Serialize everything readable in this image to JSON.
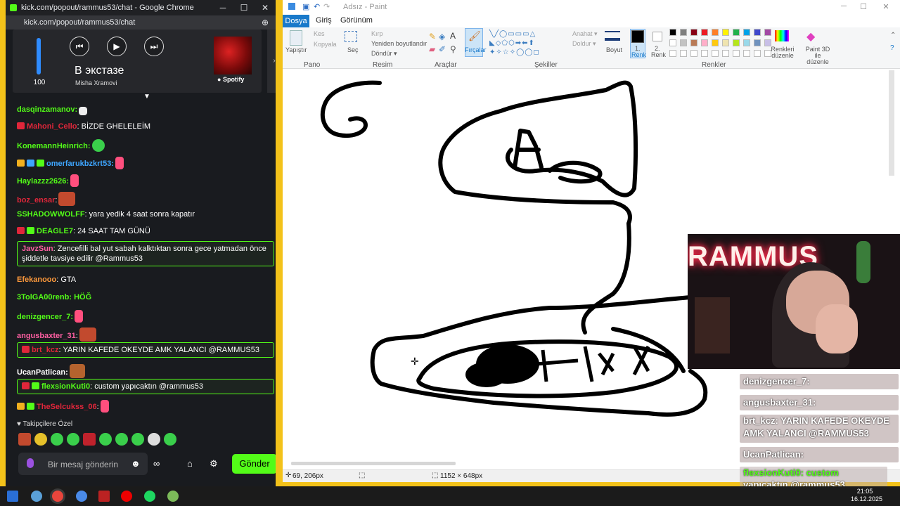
{
  "chrome": {
    "title": "kick.com/popout/rammus53/chat - Google Chrome",
    "url": "kick.com/popout/rammus53/chat",
    "minimize": "─",
    "maximize": "☐",
    "close": "✕",
    "zoom_icon": "⊕"
  },
  "spotify": {
    "volume": 100,
    "volume_label": "100",
    "song": "В экстазе",
    "artist": "Misha Xramovi",
    "logo_text": "Spotify",
    "prev_icon": "⏮",
    "play_icon": "▶",
    "next_icon": "⏭",
    "side_arrow": "›"
  },
  "chat": {
    "messages": [
      {
        "user": "dasqinzamanov:",
        "text": "",
        "color": "#53fc18"
      },
      {
        "user": "Mahoni_Cello",
        "text": ": BİZDE GHELELEİM",
        "color": "#e0263a"
      },
      {
        "user": "KonemannHeinrich:",
        "text": "",
        "color": "#53fc18"
      },
      {
        "user": "omerfarukbzkrt53:",
        "text": "",
        "color": "#3ea6ff"
      },
      {
        "user": "Haylazzz2626:",
        "text": "",
        "color": "#53fc18"
      },
      {
        "user": "boz_ensar",
        "text": ":",
        "color": "#e0263a"
      },
      {
        "user": "SSHADOWWOLFF",
        "text": ": yara yedik 4 saat sonra kapatır",
        "color": "#53fc18"
      },
      {
        "user": "DEAGLE7",
        "text": ": 24 SAAT TAM GÜNÜ",
        "color": "#53fc18"
      },
      {
        "user": "JavzSun",
        "text": ": Zencefilli bal yut sabah kalktıktan sonra gece yatmadan önce şiddetle tavsiye edilir @Rammus53",
        "color": "#ff5fa2"
      },
      {
        "user": "Efekanooo",
        "text": ": GTA",
        "color": "#ff9a3c"
      },
      {
        "user": "3TolGA00renb:",
        "text": "HÖĞ",
        "color": "#53fc18"
      },
      {
        "user": "denizgencer_7:",
        "text": "",
        "color": "#53fc18"
      },
      {
        "user": "angusbaxter_31",
        "text": ":",
        "color": "#ff5fa2"
      },
      {
        "user": "brt_kcz",
        "text": ": YARIN KAFEDE OKEYDE AMK YALANCI @RAMMUS53",
        "color": "#e0263a"
      },
      {
        "user": "UcanPatlican:",
        "text": "",
        "color": "#ffffff"
      },
      {
        "user": "flexsionKuti0",
        "text": ": custom yapıcaktın @rammus53",
        "color": "#53fc18"
      },
      {
        "user": "TheSelcukss_06",
        "text": ":",
        "color": "#e0263a"
      }
    ],
    "followers_label": "♥ Takipçilere Özel",
    "input_placeholder": "Bir mesaj gönderin",
    "send_label": "Gönder",
    "emoji_icon": "☻",
    "settings_icon": "⚙",
    "store_icon": "⌂",
    "infinity_icon": "∞"
  },
  "paint": {
    "title": "Adsız - Paint",
    "tabs": {
      "file": "Dosya",
      "home": "Giriş",
      "view": "Görünüm"
    },
    "groups": {
      "clipboard": "Pano",
      "image": "Resim",
      "tools": "Araçlar",
      "shapes": "Şekiller",
      "colors": "Renkler"
    },
    "buttons": {
      "paste": "Yapıştır",
      "cut": "Kes",
      "copy": "Kopyala",
      "select": "Seç",
      "crop": "Kırp",
      "resize": "Yeniden boyutlandır",
      "rotate": "Döndür ▾",
      "brushes": "Fırçalar",
      "outline": "Anahat ▾",
      "fill": "Doldur ▾",
      "size": "Boyut",
      "color1": "1.",
      "color1b": "Renk",
      "color2": "2.",
      "color2b": "Renk",
      "edit_colors": "Renkleri düzenle",
      "paint3d": "Paint 3D ile düzenle"
    },
    "status": {
      "cursor": "69, 206px",
      "size": "1152 × 648px"
    },
    "colors_palette": [
      "#000000",
      "#7f7f7f",
      "#880015",
      "#ed1c24",
      "#ff7f27",
      "#fff200",
      "#22b14c",
      "#00a2e8",
      "#3f48cc",
      "#a349a4",
      "#ffffff",
      "#c3c3c3",
      "#b97a57",
      "#ffaec9",
      "#ffc90e",
      "#efe4b0",
      "#b5e61d",
      "#99d9ea",
      "#7092be",
      "#c8bfe7"
    ]
  },
  "webcam": {
    "sign_text": "RAMMUS"
  },
  "overlay": [
    {
      "text": "denizgencer_7:"
    },
    {
      "text": "angusbaxter_31:"
    },
    {
      "text": "brt_kcz: YARIN KAFEDE OKEYDE"
    },
    {
      "text": "AMK YALANCI @RAMMUS53"
    },
    {
      "text": "UcanPatlican:"
    },
    {
      "text": "flexsionKuti0: custom"
    },
    {
      "text": "yapıcaktın @rammus53"
    }
  ],
  "taskbar": {
    "time": "21:05",
    "date": "16.12.2025"
  }
}
